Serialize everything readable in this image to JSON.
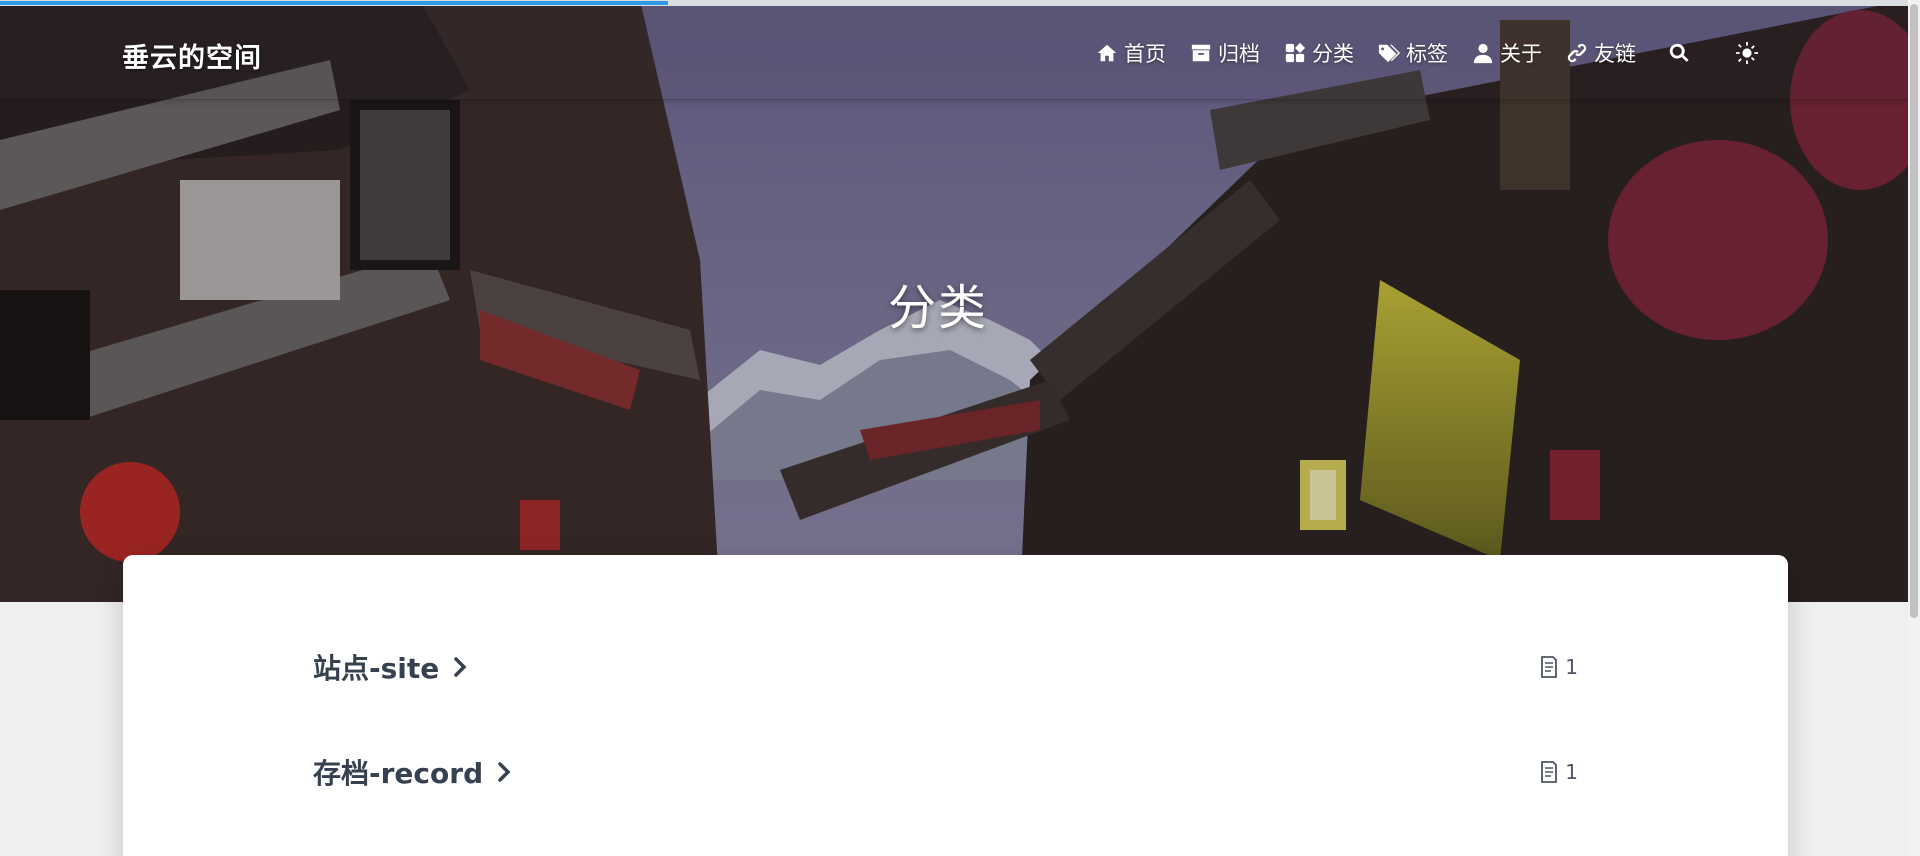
{
  "site": {
    "brand": "垂云的空间"
  },
  "reading_progress": 0.35,
  "nav": {
    "items": [
      {
        "label": "首页",
        "icon": "home-icon"
      },
      {
        "label": "归档",
        "icon": "archive-icon"
      },
      {
        "label": "分类",
        "icon": "category-icon"
      },
      {
        "label": "标签",
        "icon": "tags-icon"
      },
      {
        "label": "关于",
        "icon": "user-icon"
      },
      {
        "label": "友链",
        "icon": "link-icon"
      }
    ],
    "search_icon": "search-icon",
    "theme_icon": "sun-icon"
  },
  "hero": {
    "title": "分类"
  },
  "categories": [
    {
      "name": "站点-site",
      "count": "1"
    },
    {
      "name": "存档-record",
      "count": "1"
    }
  ],
  "colors": {
    "progress": "#2f9be6",
    "category_text": "#36404f",
    "page_bg": "#efefef"
  }
}
